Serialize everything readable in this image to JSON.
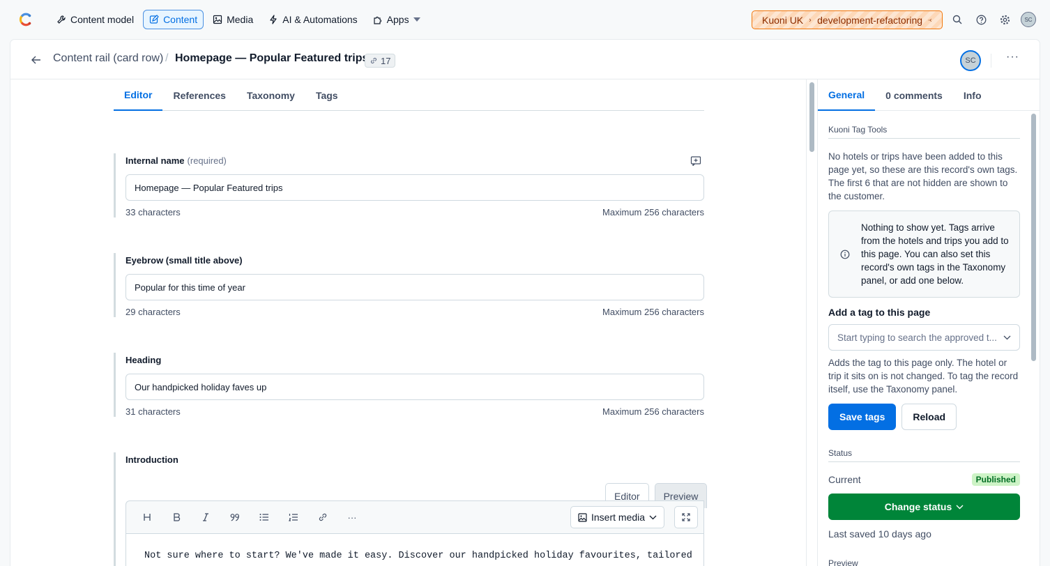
{
  "nav": {
    "items": [
      {
        "label": "Content model",
        "icon": "wrench-icon"
      },
      {
        "label": "Content",
        "icon": "edit-icon",
        "active": true
      },
      {
        "label": "Media",
        "icon": "image-icon"
      },
      {
        "label": "AI & Automations",
        "icon": "lightning-icon"
      },
      {
        "label": "Apps",
        "icon": "puzzle-icon",
        "dropdown": true
      }
    ],
    "env": {
      "space": "Kuoni UK",
      "environment": "development-refactoring"
    },
    "avatar": "SC"
  },
  "header": {
    "breadcrumb": "Content rail (card row)",
    "separator": "/",
    "title": "Homepage — Popular Featured trips",
    "references_count": "17",
    "avatar": "SC",
    "more": "···"
  },
  "editor_tabs": [
    "Editor",
    "References",
    "Taxonomy",
    "Tags"
  ],
  "fields": {
    "internal_name": {
      "label": "Internal name",
      "required": "(required)",
      "value": "Homepage — Popular Featured trips",
      "count": "33 characters",
      "max": "Maximum 256 characters"
    },
    "eyebrow": {
      "label": "Eyebrow (small title above)",
      "value": "Popular for this time of year",
      "count": "29 characters",
      "max": "Maximum 256 characters"
    },
    "heading": {
      "label": "Heading",
      "value": "Our handpicked holiday faves up",
      "count": "31 characters",
      "max": "Maximum 256 characters"
    },
    "introduction": {
      "label": "Introduction",
      "mode_tabs": [
        "Editor",
        "Preview"
      ],
      "toolbar": [
        "H",
        "B",
        "I",
        "99",
        "list",
        "numbered-list",
        "link",
        "···"
      ],
      "insert_media": "Insert media",
      "body": "Not sure where to start? We've made it easy. Discover our handpicked holiday favourites, tailored"
    }
  },
  "sidebar": {
    "tabs": [
      "General",
      "0 comments",
      "Info"
    ],
    "section_title": "Kuoni Tag Tools",
    "intro": "No hotels or trips have been added to this page yet, so these are this record's own tags. The first 6 that are not hidden are shown to the customer.",
    "notice": "Nothing to show yet. Tags arrive from the hotels and trips you add to this page. You can also set this record's own tags in the Taxonomy panel, or add one below.",
    "add_label": "Add a tag to this page",
    "select_placeholder": "Start typing to search the approved t...",
    "help": "Adds the tag to this page only. The hotel or trip it sits on is not changed. To tag the record itself, use the Taxonomy panel.",
    "save_label": "Save tags",
    "reload_label": "Reload",
    "status_title": "Status",
    "current_label": "Current",
    "status_badge": "Published",
    "change_status": "Change status",
    "last_saved": "Last saved 10 days ago",
    "preview_title": "Preview"
  }
}
